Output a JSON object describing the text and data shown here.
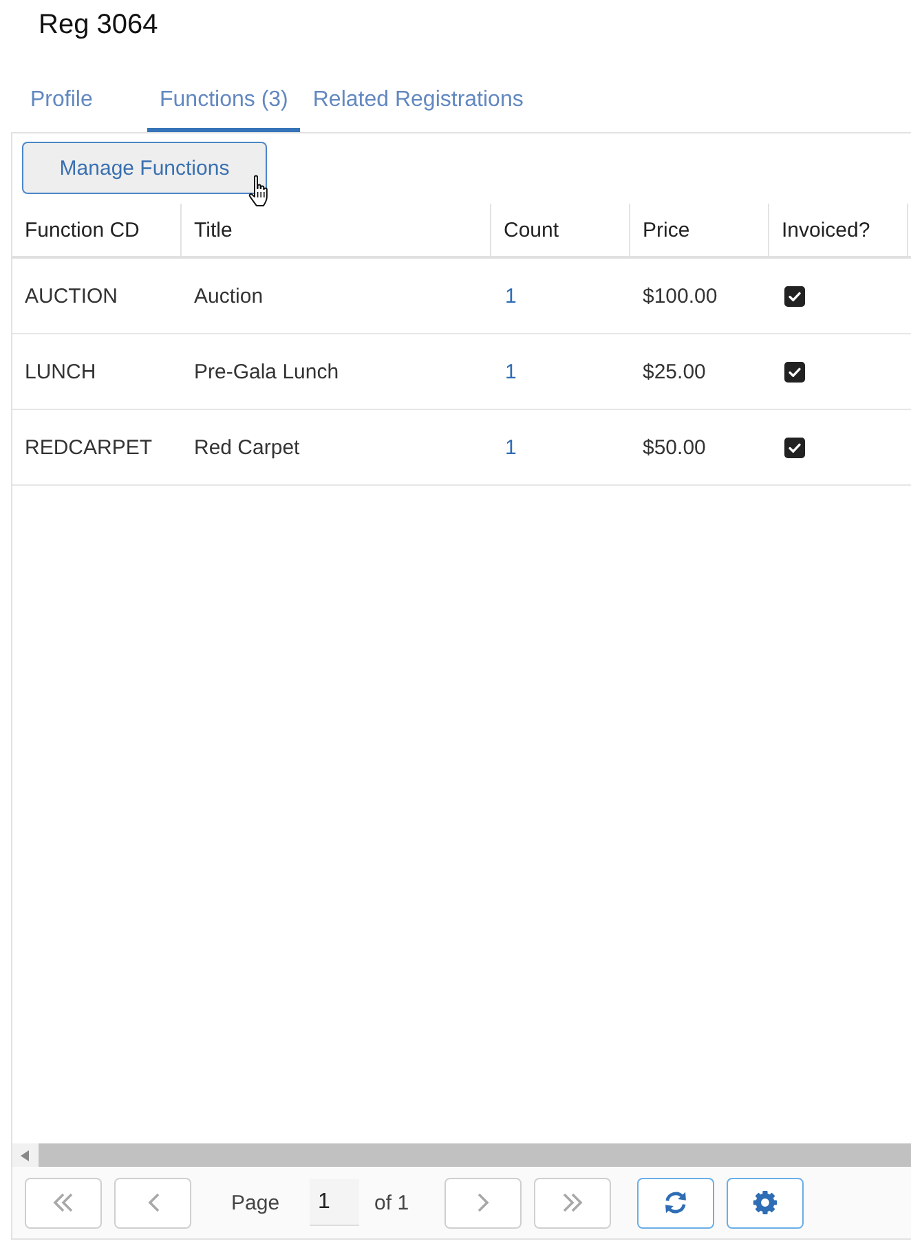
{
  "page": {
    "title": "Reg 3064"
  },
  "tabs": [
    {
      "label": "Profile",
      "selected": false
    },
    {
      "label": "Functions (3)",
      "selected": true
    },
    {
      "label": "Related Registrations",
      "selected": false
    }
  ],
  "toolbar": {
    "buttons": [
      "Manage Functions"
    ]
  },
  "table": {
    "columns": [
      "Function CD",
      "Title",
      "Count",
      "Price",
      "Invoiced?"
    ],
    "rows": [
      {
        "function_cd": "AUCTION",
        "title": "Auction",
        "count": "1",
        "price": "$100.00",
        "invoiced": true
      },
      {
        "function_cd": "LUNCH",
        "title": "Pre-Gala Lunch",
        "count": "1",
        "price": "$25.00",
        "invoiced": true
      },
      {
        "function_cd": "REDCARPET",
        "title": "Red Carpet",
        "count": "1",
        "price": "$50.00",
        "invoiced": true
      }
    ]
  },
  "pager": {
    "buttons": [
      {
        "kind": "first",
        "disabled": true
      },
      {
        "kind": "prev",
        "disabled": true
      },
      {
        "kind": "next",
        "disabled": true
      },
      {
        "kind": "last",
        "disabled": true
      },
      {
        "kind": "refresh",
        "disabled": false
      },
      {
        "kind": "settings",
        "disabled": false
      }
    ],
    "page_label": "Page",
    "page": "1",
    "of_label": "of 1"
  }
}
